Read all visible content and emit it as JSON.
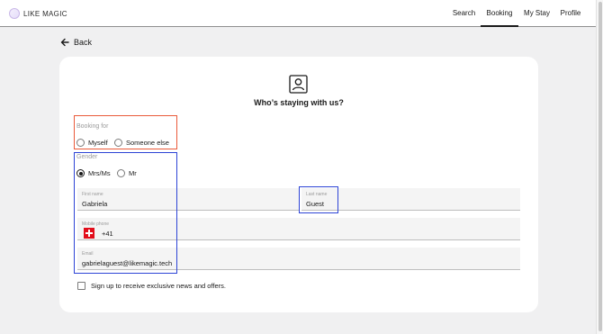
{
  "brand": {
    "name": "LIKE MAGIC"
  },
  "nav": {
    "items": [
      {
        "label": "Search",
        "active": false
      },
      {
        "label": "Booking",
        "active": true
      },
      {
        "label": "My Stay",
        "active": false
      },
      {
        "label": "Profile",
        "active": false
      }
    ]
  },
  "back": {
    "label": "Back"
  },
  "card": {
    "title": "Who’s staying with us?",
    "booking_for": {
      "label": "Booking for",
      "options": [
        "Myself",
        "Someone else"
      ],
      "selected": null
    },
    "gender": {
      "label": "Gender",
      "options": [
        "Mrs/Ms",
        "Mr"
      ],
      "selected": "Mrs/Ms"
    },
    "first_name": {
      "label": "First name",
      "value": "Gabriela"
    },
    "last_name": {
      "label": "Last name",
      "value": "Guest"
    },
    "mobile_phone": {
      "label": "Mobile phone",
      "country_code": "+41",
      "flag_icon": "swiss-flag-icon"
    },
    "email": {
      "label": "Email",
      "value": "gabrielaguest@likemagic.tech"
    },
    "newsletter": {
      "label": "Sign up to receive exclusive news and offers.",
      "checked": false
    }
  },
  "colors": {
    "highlight_red": "#ea5a3a",
    "highlight_blue": "#2d44d6",
    "swiss_red": "#e20d1b"
  }
}
